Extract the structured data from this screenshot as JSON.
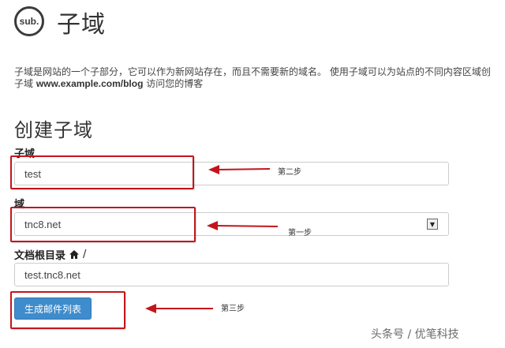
{
  "header": {
    "logo_text": "sub.",
    "title": "子域"
  },
  "description": {
    "line1": "子域是网站的一个子部分，它可以作为新网站存在，而且不需要新的域名。 使用子域可以为站点的不同内容区域创",
    "line2_bold": "www.example.com/blog",
    "line2_prefix": "子域",
    "line2_suffix": " 访问您的博客"
  },
  "form": {
    "section_title": "创建子域",
    "subdomain_label": "子域",
    "subdomain_value": "test",
    "domain_label": "域",
    "domain_value": "tnc8.net",
    "docroot_label": "文档根目录",
    "docroot_slash": "/",
    "docroot_value": "test.tnc8.net",
    "submit_label": "生成邮件列表"
  },
  "annotations": {
    "step1": "第一步",
    "step2": "第二步",
    "step3": "第三步",
    "highlight_color": "#c4151c"
  },
  "watermark": "头条号 / 优笔科技"
}
